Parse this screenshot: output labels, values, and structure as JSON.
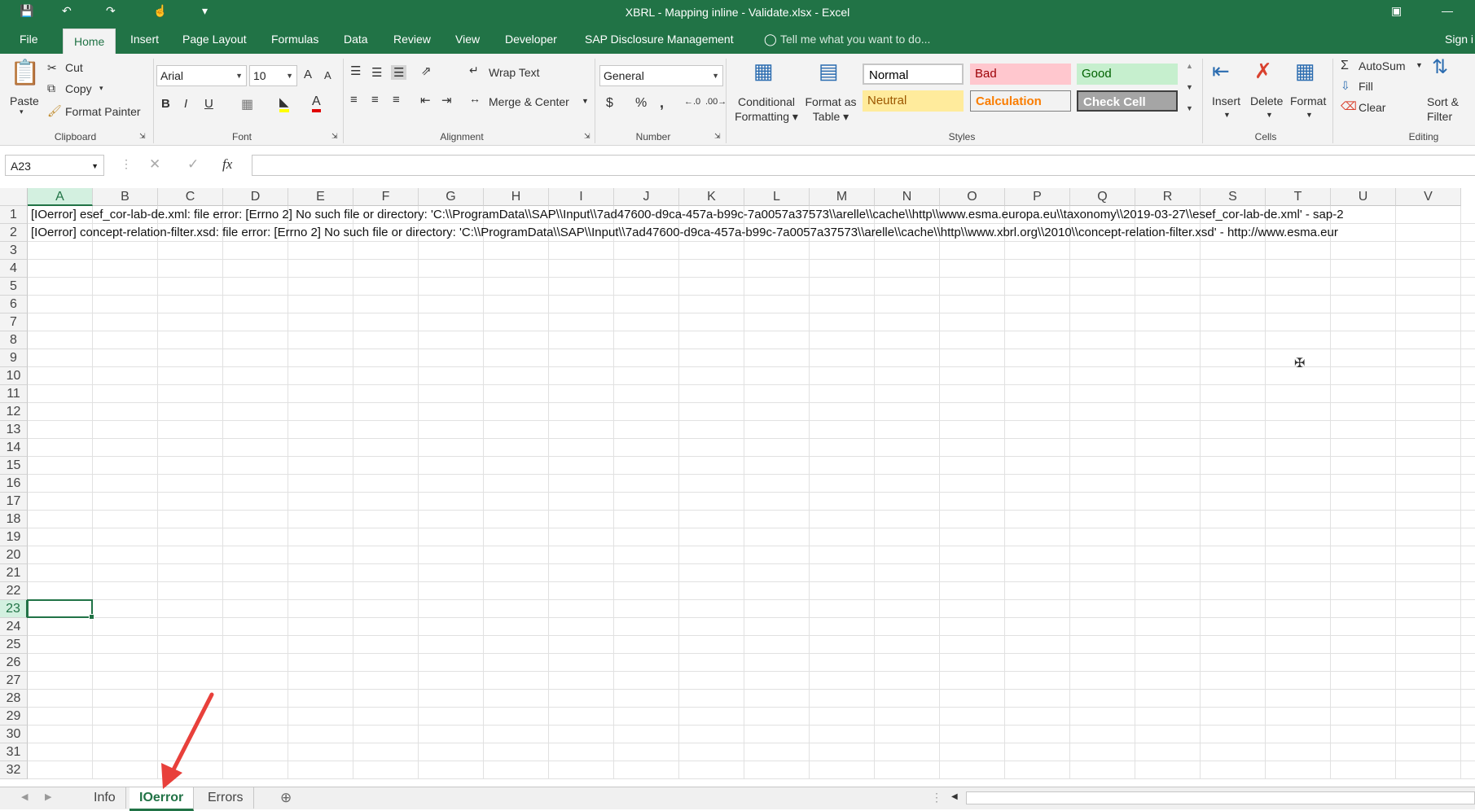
{
  "window": {
    "title": "XBRL - Mapping inline - Validate.xlsx - Excel"
  },
  "menu_tabs": [
    "File",
    "Home",
    "Insert",
    "Page Layout",
    "Formulas",
    "Data",
    "Review",
    "View",
    "Developer",
    "SAP Disclosure Management"
  ],
  "active_tab": "Home",
  "tell_me": "Tell me what you want to do...",
  "sign_in": "Sign i",
  "clipboard": {
    "paste": "Paste",
    "cut": "Cut",
    "copy": "Copy",
    "format_painter": "Format Painter",
    "group": "Clipboard"
  },
  "font": {
    "name": "Arial",
    "size": "10",
    "group": "Font",
    "bold": "B",
    "italic": "I",
    "underline": "U",
    "grow": "A",
    "shrink": "A"
  },
  "alignment": {
    "wrap": "Wrap Text",
    "merge": "Merge & Center",
    "group": "Alignment"
  },
  "number": {
    "format": "General",
    "currency": "$",
    "percent": "%",
    "comma": ",",
    "group": "Number"
  },
  "styles": {
    "conditional": [
      "Conditional",
      "Formatting"
    ],
    "format_table": [
      "Format as",
      "Table"
    ],
    "group": "Styles",
    "cells": [
      {
        "label": "Normal",
        "bg": "#ffffff",
        "fg": "#000000"
      },
      {
        "label": "Bad",
        "bg": "#ffc7ce",
        "fg": "#9c0006"
      },
      {
        "label": "Good",
        "bg": "#c6efce",
        "fg": "#006100"
      },
      {
        "label": "Neutral",
        "bg": "#ffeb9c",
        "fg": "#9c5700"
      },
      {
        "label": "Calculation",
        "bg": "#f2f2f2",
        "fg": "#fa7d00"
      },
      {
        "label": "Check Cell",
        "bg": "#a5a5a5",
        "fg": "#ffffff"
      }
    ]
  },
  "cells_group": {
    "insert": "Insert",
    "delete": "Delete",
    "format": "Format",
    "group": "Cells"
  },
  "editing": {
    "autosum": "AutoSum",
    "fill": "Fill",
    "clear": "Clear",
    "sort": [
      "Sort &",
      "Filter"
    ],
    "group": "Editing"
  },
  "formula_bar": {
    "name_box": "A23",
    "fx": "fx",
    "value": ""
  },
  "columns": [
    "A",
    "B",
    "C",
    "D",
    "E",
    "F",
    "G",
    "H",
    "I",
    "J",
    "K",
    "L",
    "M",
    "N",
    "O",
    "P",
    "Q",
    "R",
    "S",
    "T",
    "U",
    "V"
  ],
  "row_count": 32,
  "active_cell": {
    "column": "A",
    "row": 23
  },
  "rows": [
    "[IOerror] esef_cor-lab-de.xml: file error: [Errno 2] No such file or directory: 'C:\\\\ProgramData\\\\SAP\\\\Input\\\\7ad47600-d9ca-457a-b99c-7a0057a37573\\\\arelle\\\\cache\\\\http\\\\www.esma.europa.eu\\\\taxonomy\\\\2019-03-27\\\\esef_cor-lab-de.xml' - sap-2",
    "[IOerror] concept-relation-filter.xsd: file error: [Errno 2] No such file or directory: 'C:\\\\ProgramData\\\\SAP\\\\Input\\\\7ad47600-d9ca-457a-b99c-7a0057a37573\\\\arelle\\\\cache\\\\http\\\\www.xbrl.org\\\\2010\\\\concept-relation-filter.xsd' - http://www.esma.eur"
  ],
  "sheets": [
    {
      "label": "Info"
    },
    {
      "label": "IOerror",
      "active": true
    },
    {
      "label": "Errors"
    }
  ],
  "accent": "#217346"
}
